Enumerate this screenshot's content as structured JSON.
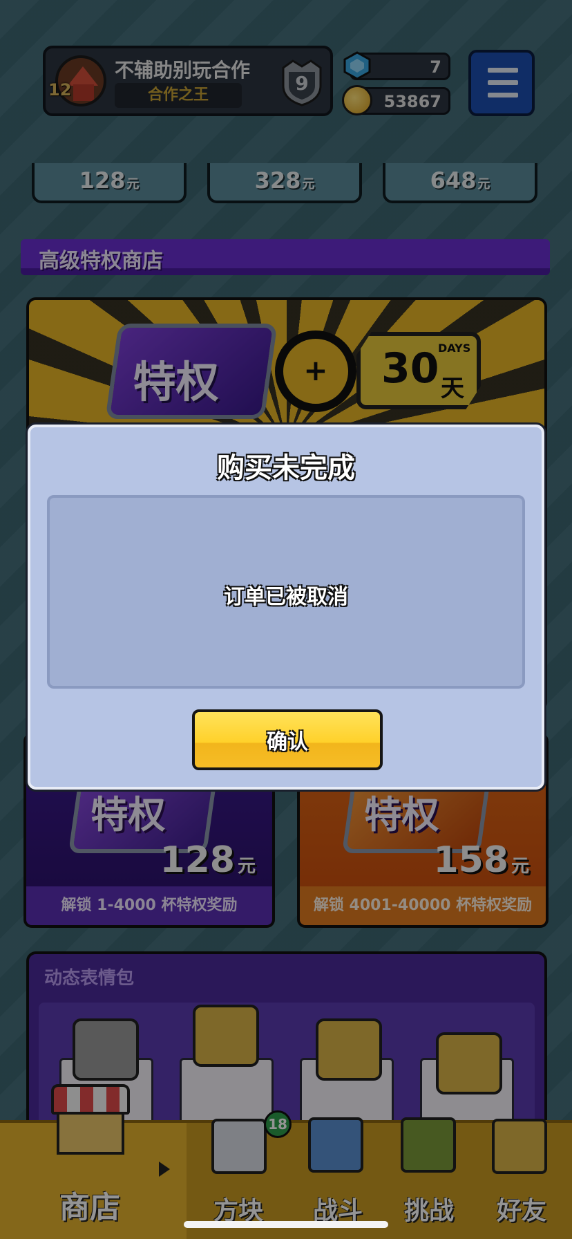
{
  "player": {
    "name": "不辅助别玩合作",
    "title": "合作之王",
    "level": "12",
    "rank": "9"
  },
  "currency": {
    "gems": "7",
    "coins": "53867"
  },
  "recharge": [
    {
      "amount": "128",
      "unit": "元"
    },
    {
      "amount": "328",
      "unit": "元"
    },
    {
      "amount": "648",
      "unit": "元"
    }
  ],
  "premium_shop": {
    "title": "高级特权商店",
    "banner": {
      "privilege_label": "特权",
      "plus": "+",
      "days_number": "30",
      "days_unit": "天",
      "days_word": "DAYS"
    },
    "cards": [
      {
        "label": "特权",
        "price": "128",
        "unit": "元",
        "desc": "解锁 1-4000 杯特权奖励"
      },
      {
        "label": "特权",
        "price": "158",
        "unit": "元",
        "desc": "解锁 4001-40000 杯特权奖励"
      }
    ]
  },
  "emoji_pack": {
    "title": "动态表情包"
  },
  "nav": {
    "shop": "商店",
    "blocks": "方块",
    "blocks_badge": "18",
    "battle": "战斗",
    "challenge": "挑战",
    "friends": "好友"
  },
  "dialog": {
    "title": "购买未完成",
    "message": "订单已被取消",
    "confirm_label": "确认"
  },
  "colors": {
    "accent_purple": "#6a2fd0",
    "confirm_yellow": "#ffd12a",
    "menu_blue": "#1d4fb0"
  }
}
